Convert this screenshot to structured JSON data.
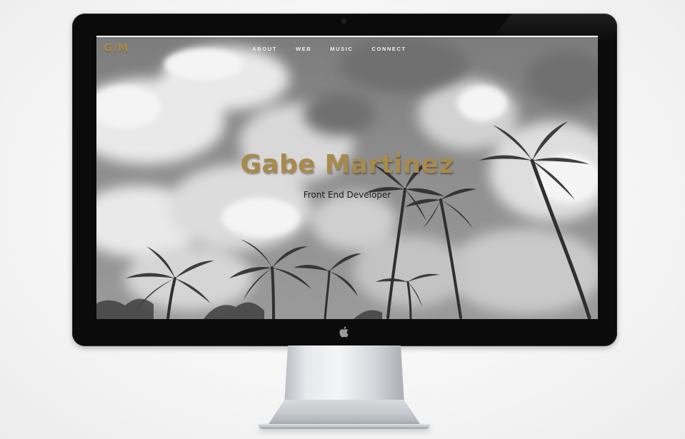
{
  "site": {
    "logo": "G/M",
    "nav": {
      "items": [
        {
          "label": "ABOUT"
        },
        {
          "label": "WEB"
        },
        {
          "label": "MUSIC"
        },
        {
          "label": "CONNECT"
        }
      ]
    },
    "hero": {
      "title": "Gabe Martinez",
      "subtitle": "Front End Developer"
    }
  },
  "colors": {
    "accent_gold": "#a88a4c",
    "bezel": "#0b0b0b",
    "nav_text": "#f2f2f2",
    "subtitle_text": "#1d1d1d"
  },
  "icons": {
    "brand": "apple-icon",
    "camera": "camera-icon"
  }
}
